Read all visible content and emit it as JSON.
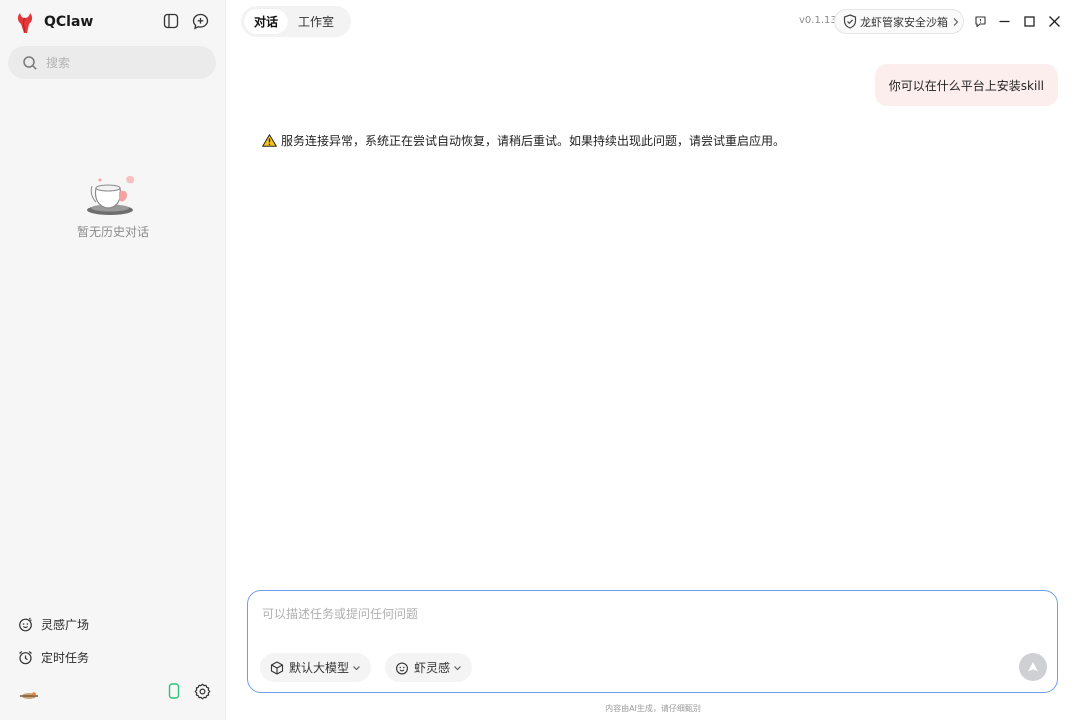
{
  "app": {
    "name": "QClaw",
    "version": "v0.1.13"
  },
  "colors": {
    "accent_border": "#6f9ef2",
    "user_bubble": "#fdeeee",
    "brand_red": "#e5383b"
  },
  "sidebar": {
    "search_placeholder": "搜索",
    "empty_text": "暂无历史对话",
    "nav": [
      {
        "label": "灵感广场",
        "icon": "smile-face-icon"
      },
      {
        "label": "定时任务",
        "icon": "alarm-clock-icon"
      }
    ]
  },
  "tabs": [
    {
      "label": "对话",
      "active": true
    },
    {
      "label": "工作室",
      "active": false
    }
  ],
  "sandbox": {
    "label": "龙虾管家安全沙箱"
  },
  "chat": {
    "user_message": "你可以在什么平台上安装skill",
    "error_message": "服务连接异常，系统正在尝试自动恢复，请稍后重试。如果持续出现此问题，请尝试重启应用。"
  },
  "composer": {
    "placeholder": "可以描述任务或提问任何问题",
    "model_label": "默认大模型",
    "inspiration_label": "虾灵感"
  },
  "disclaimer": "内容由AI生成，请仔细甄别"
}
